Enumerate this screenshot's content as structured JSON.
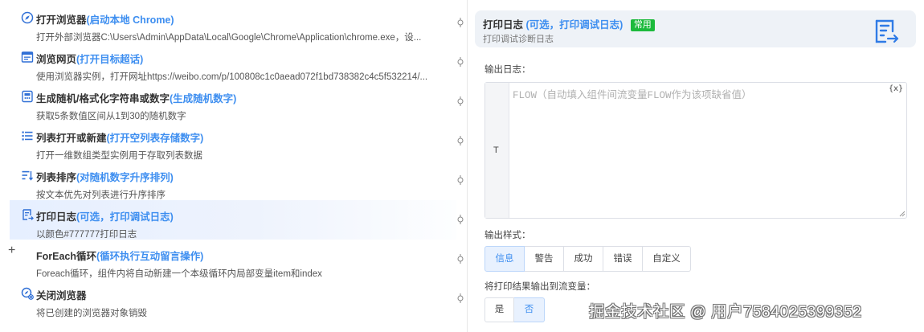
{
  "steps": [
    {
      "icon": "compass-icon",
      "title": "打开浏览器",
      "hint": "(启动本地 Chrome)",
      "desc": "打开外部浏览器C:\\Users\\Admin\\AppData\\Local\\Google\\Chrome\\Application\\chrome.exe，设..."
    },
    {
      "icon": "webpage-icon",
      "title": "浏览网页",
      "hint": "(打开目标超话)",
      "desc": "使用浏览器实例，打开网址https://weibo.com/p/100808c1c0aead072f1bd738382c4c5f532214/..."
    },
    {
      "icon": "random-icon",
      "title": "生成随机/格式化字符串或数字",
      "hint": "(生成随机数字)",
      "desc": "获取5条数值区间从1到30的随机数字"
    },
    {
      "icon": "list-icon",
      "title": "列表打开或新建",
      "hint": "(打开空列表存储数字)",
      "desc": "打开一维数组类型实例用于存取列表数据"
    },
    {
      "icon": "sort-icon",
      "title": "列表排序",
      "hint": "(对随机数字升序排列)",
      "desc": "按文本优先对列表进行升序排序"
    },
    {
      "icon": "log-icon",
      "title": "打印日志",
      "hint": "(可选，打印调试日志)",
      "desc": "以颜色#777777打印日志"
    },
    {
      "icon": "",
      "title": "ForEach循环",
      "hint": "(循环执行互动留言操作)",
      "desc": "Foreach循环，组件内将自动新建一个本级循环内局部变量item和index"
    },
    {
      "icon": "close-browser-icon",
      "title": "关闭浏览器",
      "hint": "",
      "desc": "将已创建的浏览器对象销毁"
    }
  ],
  "expand_symbol": "+",
  "panel": {
    "title": "打印日志",
    "hint": "(可选，打印调试日志)",
    "badge": "常用",
    "subtitle": "打印调试诊断日志",
    "icon": "log-icon",
    "output_log_label": "输出日志：",
    "type_indicator": "T",
    "placeholder": "FLOW（自动填入组件间流变量FLOW作为该项缺省值）",
    "var_button": "{x}",
    "style_label": "输出样式：",
    "styles": [
      "信息",
      "警告",
      "成功",
      "错误",
      "自定义"
    ],
    "selected_style": "信息",
    "output_to_var_label": "将打印结果输出到流变量：",
    "yes": "是",
    "no": "否",
    "selected_yesno": "否"
  },
  "watermark": "掘金技术社区 @ 用户7584025399352",
  "colors": {
    "accent": "#3d8ef0",
    "badge": "#1cba3c",
    "active_row": "#e6efff"
  }
}
